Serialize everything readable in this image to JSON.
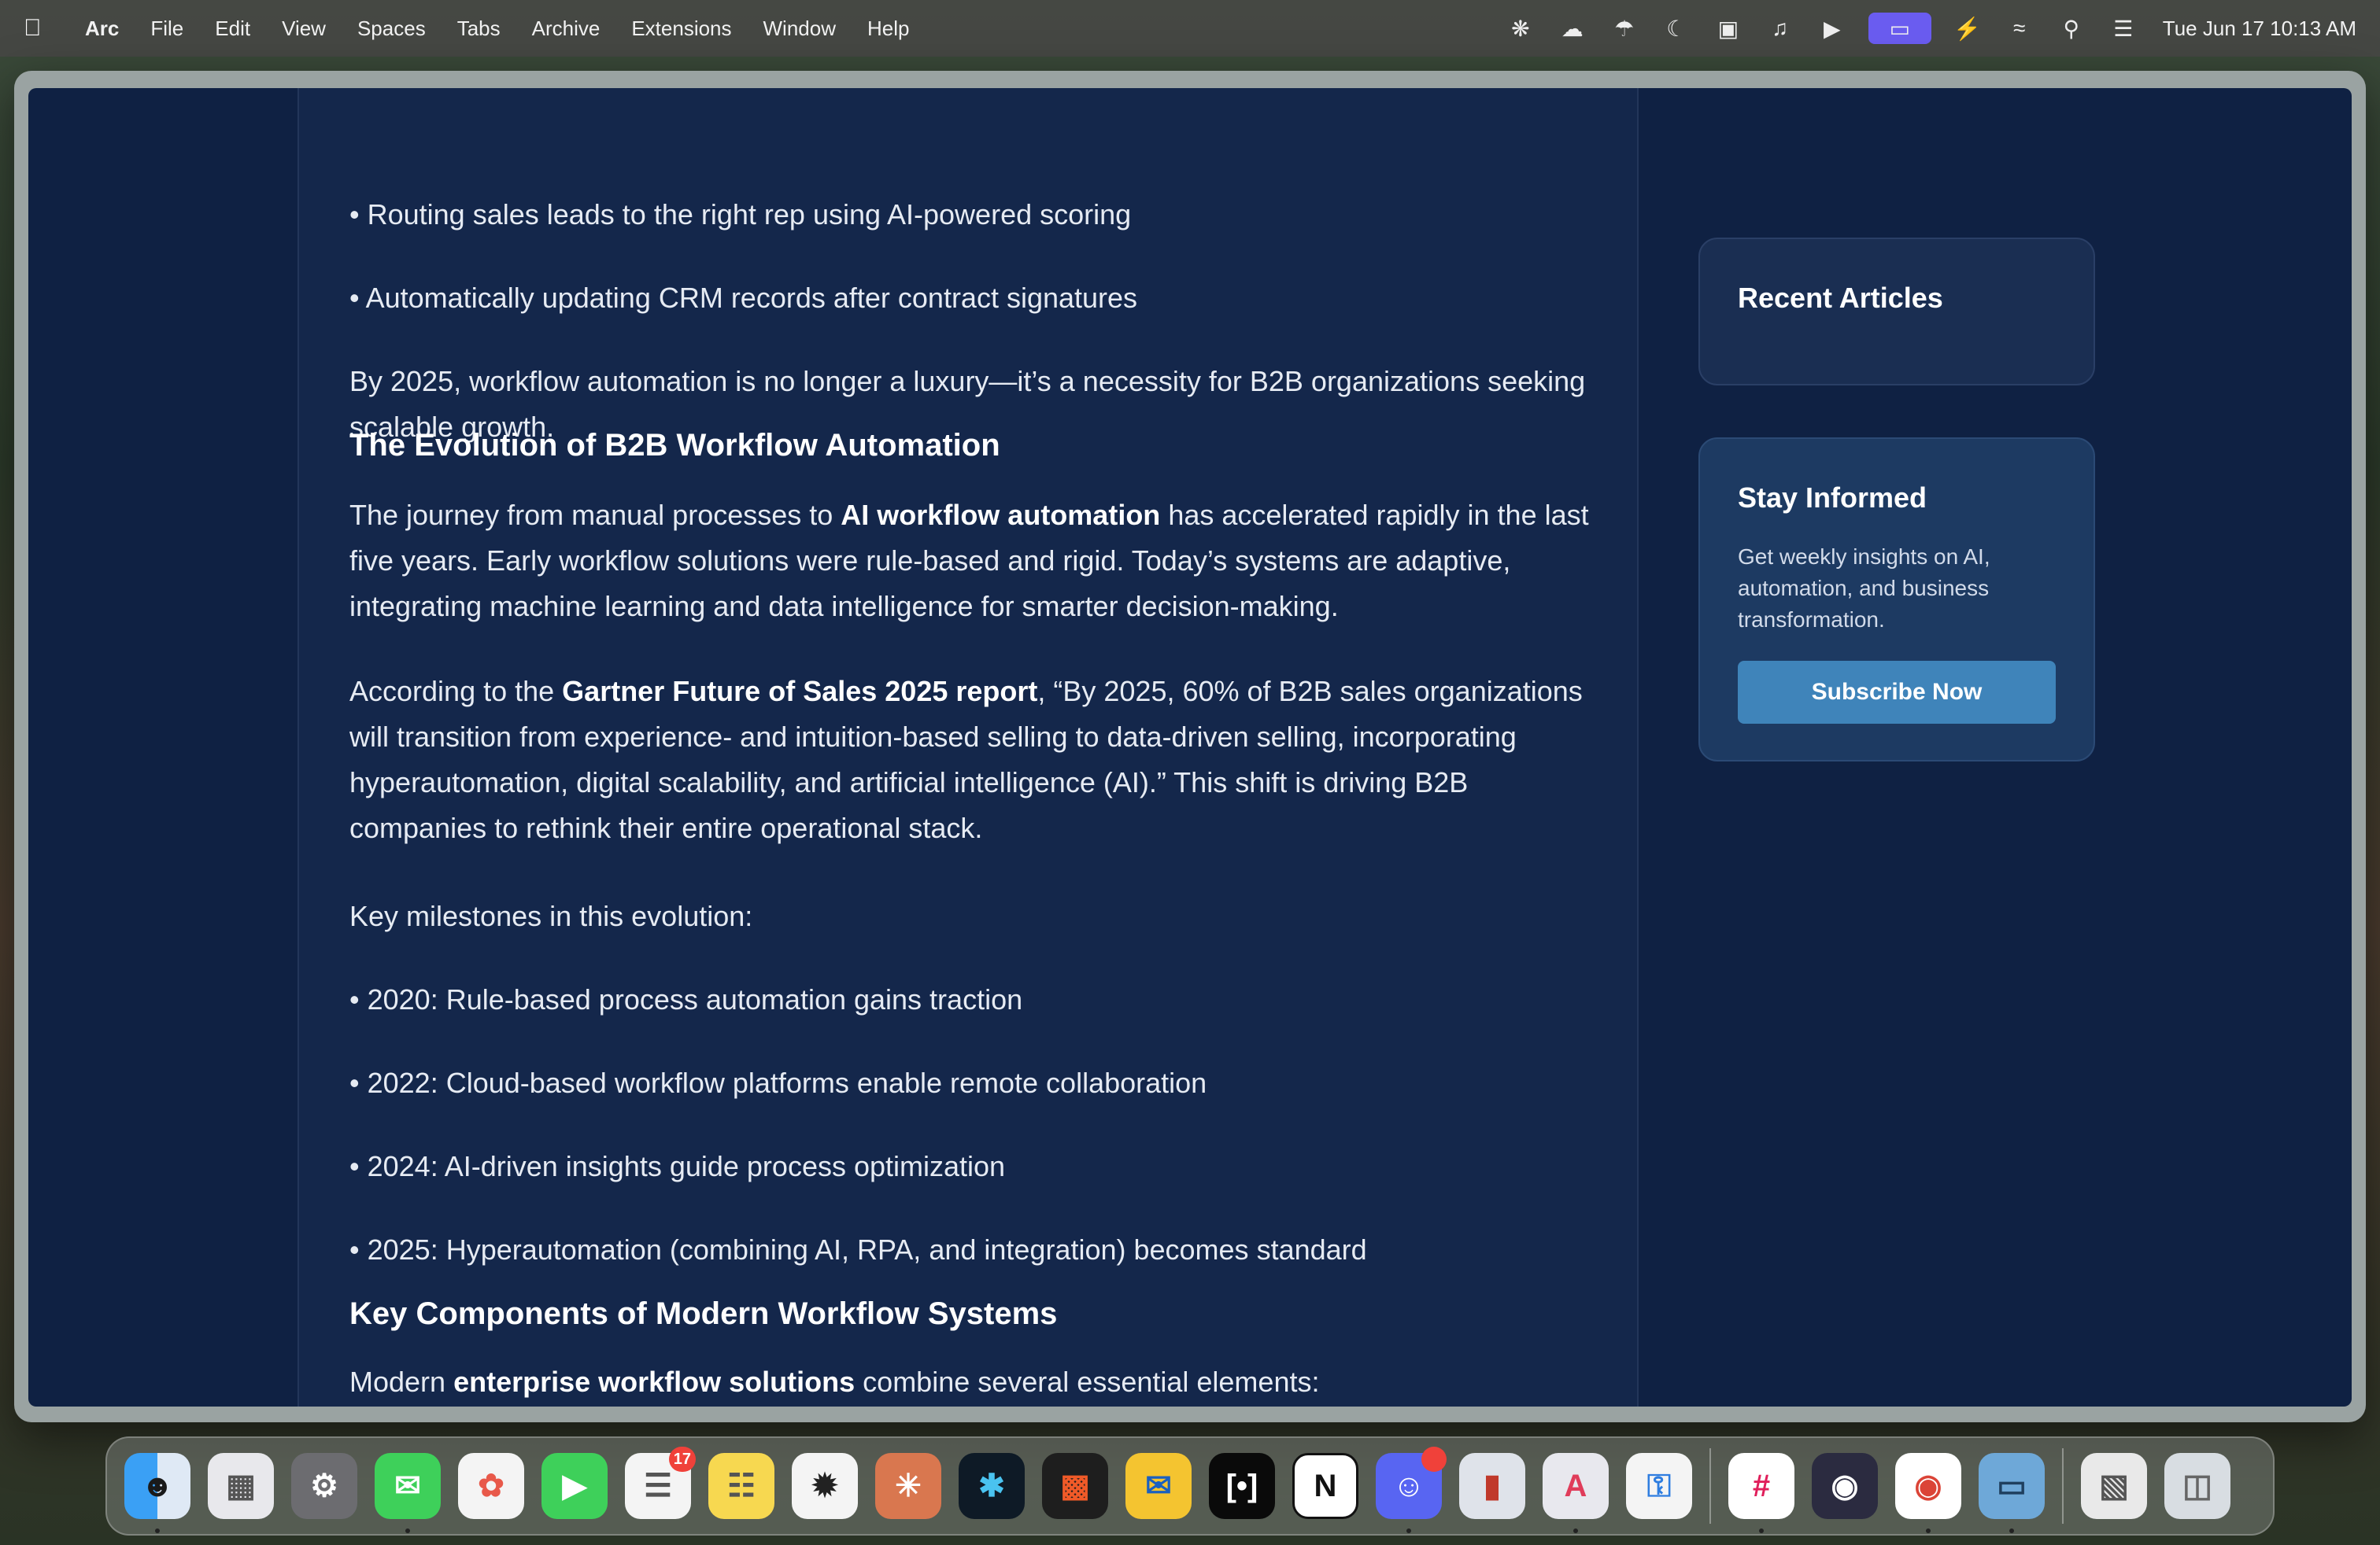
{
  "menubar": {
    "app_name": "Arc",
    "items": [
      "File",
      "Edit",
      "View",
      "Spaces",
      "Tabs",
      "Archive",
      "Extensions",
      "Window",
      "Help"
    ],
    "clock": "Tue Jun 17  10:13 AM"
  },
  "article": {
    "bullets_top": [
      "• Routing sales leads to the right rep using AI-powered scoring",
      "• Automatically updating CRM records after contract signatures"
    ],
    "p1": "By 2025, workflow automation is no longer a luxury—it’s a necessity for B2B organizations seeking scalable growth.",
    "h1": "The Evolution of B2B Workflow Automation",
    "p2": {
      "pre": "The journey from manual processes to ",
      "bold": "AI workflow automation",
      "post": " has accelerated rapidly in the last five years. Early workflow solutions were rule-based and rigid. Today’s systems are adaptive, integrating machine learning and data intelligence for smarter decision-making."
    },
    "p3": {
      "pre": "According to the ",
      "bold": "Gartner Future of Sales 2025 report",
      "post": ", “By 2025, 60% of B2B sales organizations will transition from experience- and intuition-based selling to data-driven selling, incorporating hyperautomation, digital scalability, and artificial intelligence (AI).” This shift is driving B2B companies to rethink their entire operational stack."
    },
    "p4": "Key milestones in this evolution:",
    "milestones": [
      "• 2020: Rule-based process automation gains traction",
      "• 2022: Cloud-based workflow platforms enable remote collaboration",
      "• 2024: AI-driven insights guide process optimization",
      "• 2025: Hyperautomation (combining AI, RPA, and integration) becomes standard"
    ],
    "h2": "Key Components of Modern Workflow Systems",
    "p5": {
      "pre": "Modern ",
      "bold": "enterprise workflow solutions",
      "post": " combine several essential elements:"
    }
  },
  "sidebar": {
    "recent_title": "Recent Articles",
    "stay_title": "Stay Informed",
    "stay_desc": "Get weekly insights on AI, automation, and business transformation.",
    "subscribe_label": "Subscribe Now"
  },
  "dock": {
    "reminders_badge": "17"
  },
  "colors": {
    "page_bg": "#0f2143",
    "article_bg": "#14274b",
    "button": "#3f84ba"
  }
}
